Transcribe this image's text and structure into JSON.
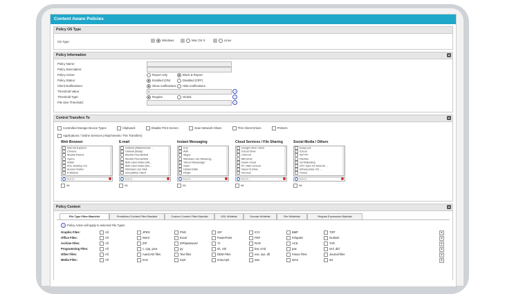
{
  "window": {
    "title": "Content Aware Policies"
  },
  "policy_os": {
    "header": "Policy OS Type",
    "label": "OS Type:",
    "options": [
      "Windows",
      "Mac OS X",
      "Linux"
    ]
  },
  "policy_info": {
    "header": "Policy Information",
    "fields": [
      "Policy Name:",
      "Policy Description:",
      "Policy Action:",
      "Policy Status:",
      "Client Notifications:",
      "Threshold Value:",
      "Threshold Type:",
      "File Size Threshold:"
    ],
    "action_opts": [
      "Report only",
      "Block & Report"
    ],
    "status_opts": [
      "Enabled (ON)",
      "Disabled (OFF)"
    ],
    "notif_opts": [
      "Show notifications",
      "Hide notifications"
    ],
    "threshold_value": "1",
    "threshold_type_opts": [
      "Regular",
      "Global"
    ]
  },
  "control": {
    "header": "Control Transfers To",
    "checks": [
      "Controlled Storage Device Types",
      "Clipboard",
      "Disable Print Screen",
      "Scan Network Share",
      "Thin Client Drives",
      "Printers"
    ],
    "apps_check": "Applications / Online Services (Attachments / File Transfers)",
    "columns": [
      {
        "title": "Web Browser",
        "items": [
          "Internet Explorer",
          "Chrome",
          "Mozilla Firefox",
          "Opera",
          "Safari",
          "AOL Desktop 9.6",
          "Aurora Firefox",
          "K-Meleon",
          "Netscape"
        ]
      },
      {
        "title": "E-mail",
        "items": [
          "Outlook (Attachments ...",
          "Outlook (Body)",
          "Mozilla Thunderbird",
          "Mozilla Thunderbird ...",
          "IBM Lotus Notes (Att...",
          "IBM Lotus Notes (Bo...",
          "Windows Live Mail",
          "GroupWise Client",
          "Outlook Express"
        ]
      },
      {
        "title": "Instant Messaging",
        "items": [
          "ICQ",
          "AIM",
          "Skype",
          "Windows Live Messeng...",
          "Yahoo! Messenger",
          "Gaim",
          "HardensTalk",
          "Pidgin",
          "Trillian"
        ]
      },
      {
        "title": "Cloud Services / File Sharing",
        "items": [
          "Google Drive Client",
          "iCloud Drive",
          "uTorrent",
          "BitComet",
          "Daum Cloud",
          "KT Olleh uCloud",
          "Naver N Drive",
          "Azureus",
          "OneDrive (Skydrive)"
        ]
      },
      {
        "title": "Social Media / Others",
        "items": [
          "EasyLock",
          "iCloud",
          "AUTTP",
          "File2Bu",
          "GoToMeeting",
          "HTC Sync for Android ...",
          "Infrarecorder CD ...",
          "iTunes",
          "LastPass Pro"
        ]
      }
    ],
    "search_placeholder": "Search...",
    "all_label": "All"
  },
  "content": {
    "header": "Policy Content",
    "tabs": [
      "File Type Filter Blacklist",
      "Predefined Content Filter Blacklist",
      "Custom Content Filter Blacklist",
      "URL Whitelist",
      "Domain Whitelist",
      "File Whitelists",
      "Regular Expression Blacklist"
    ],
    "note": "Policy Action will apply to selected File Types",
    "rows": [
      {
        "label": "Graphic Files:",
        "items": [
          "All",
          "JPEG",
          "PNG",
          "GIF",
          "ICO",
          "BMP",
          "TIFF"
        ]
      },
      {
        "label": "Office Files:",
        "items": [
          "All",
          "Word",
          "Excel",
          "PowerPoint",
          "PDF",
          "InfopatH",
          "Outlook"
        ]
      },
      {
        "label": "Archive Files:",
        "items": [
          "All",
          "ZIP",
          "ZIP/password",
          "7z",
          "RAR",
          "ACE",
          "TAR"
        ]
      },
      {
        "label": "Programming Files:",
        "items": [
          "All",
          "c, cpp, java",
          "py",
          "sh, csh",
          "bat, cmd",
          "pas",
          "xml, dtd"
        ]
      },
      {
        "label": "Other Files:",
        "items": [
          "All",
          "AutoCAD files",
          "Text files",
          "DEM Files",
          "exe, sys, dll",
          "Fasoo Files",
          "Journal files"
        ]
      },
      {
        "label": "Media Files:",
        "items": [
          "All",
          "mov",
          "mp3",
          "m4a,mp4",
          "wav",
          "wma",
          "avi"
        ]
      }
    ]
  }
}
